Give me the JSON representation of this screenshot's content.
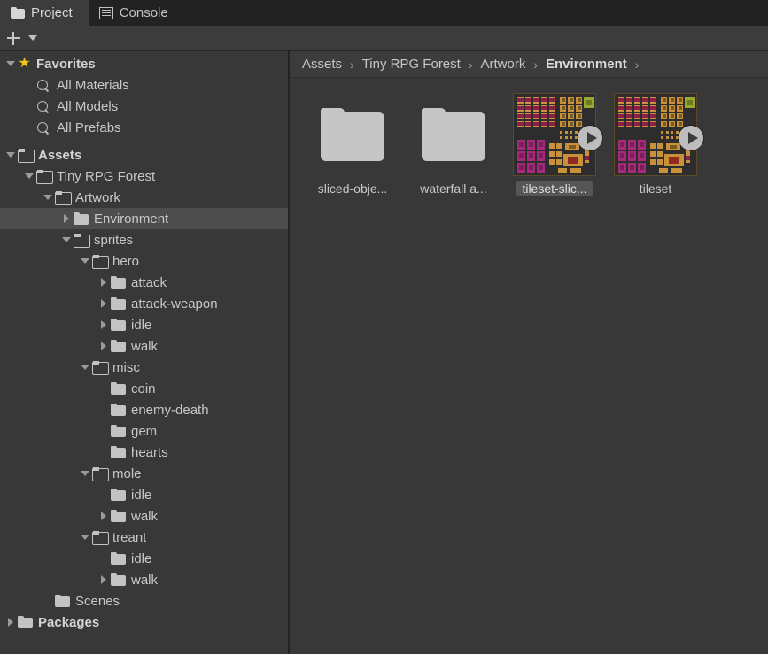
{
  "tabs": [
    {
      "label": "Project",
      "icon": "folder-icon",
      "active": true
    },
    {
      "label": "Console",
      "icon": "console-lines-icon",
      "active": false
    }
  ],
  "toolbar": {
    "add_label": "+",
    "add_icon": "plus-icon",
    "dropdown_icon": "chevron-down-icon"
  },
  "tree": [
    {
      "label": "Favorites",
      "indent": 0,
      "arrow": "down",
      "icon": "star-icon",
      "bold": true,
      "selected": false
    },
    {
      "label": "All Materials",
      "indent": 1,
      "arrow": "none",
      "icon": "search-icon",
      "bold": false,
      "selected": false
    },
    {
      "label": "All Models",
      "indent": 1,
      "arrow": "none",
      "icon": "search-icon",
      "bold": false,
      "selected": false
    },
    {
      "label": "All Prefabs",
      "indent": 1,
      "arrow": "none",
      "icon": "search-icon",
      "bold": false,
      "selected": false
    },
    {
      "label": "",
      "indent": 0,
      "arrow": "none",
      "icon": "spacer",
      "bold": false,
      "selected": false
    },
    {
      "label": "Assets",
      "indent": 0,
      "arrow": "down",
      "icon": "folder-open-icon",
      "bold": true,
      "selected": false
    },
    {
      "label": "Tiny RPG Forest",
      "indent": 1,
      "arrow": "down",
      "icon": "folder-open-icon",
      "bold": false,
      "selected": false
    },
    {
      "label": "Artwork",
      "indent": 2,
      "arrow": "down",
      "icon": "folder-open-icon",
      "bold": false,
      "selected": false
    },
    {
      "label": "Environment",
      "indent": 3,
      "arrow": "right",
      "icon": "folder-icon",
      "bold": false,
      "selected": true
    },
    {
      "label": "sprites",
      "indent": 3,
      "arrow": "down",
      "icon": "folder-open-icon",
      "bold": false,
      "selected": false
    },
    {
      "label": "hero",
      "indent": 4,
      "arrow": "down",
      "icon": "folder-open-icon",
      "bold": false,
      "selected": false
    },
    {
      "label": "attack",
      "indent": 5,
      "arrow": "right",
      "icon": "folder-icon",
      "bold": false,
      "selected": false
    },
    {
      "label": "attack-weapon",
      "indent": 5,
      "arrow": "right",
      "icon": "folder-icon",
      "bold": false,
      "selected": false
    },
    {
      "label": "idle",
      "indent": 5,
      "arrow": "right",
      "icon": "folder-icon",
      "bold": false,
      "selected": false
    },
    {
      "label": "walk",
      "indent": 5,
      "arrow": "right",
      "icon": "folder-icon",
      "bold": false,
      "selected": false
    },
    {
      "label": "misc",
      "indent": 4,
      "arrow": "down",
      "icon": "folder-open-icon",
      "bold": false,
      "selected": false
    },
    {
      "label": "coin",
      "indent": 5,
      "arrow": "none",
      "icon": "folder-icon",
      "bold": false,
      "selected": false
    },
    {
      "label": "enemy-death",
      "indent": 5,
      "arrow": "none",
      "icon": "folder-icon",
      "bold": false,
      "selected": false
    },
    {
      "label": "gem",
      "indent": 5,
      "arrow": "none",
      "icon": "folder-icon",
      "bold": false,
      "selected": false
    },
    {
      "label": "hearts",
      "indent": 5,
      "arrow": "none",
      "icon": "folder-icon",
      "bold": false,
      "selected": false
    },
    {
      "label": "mole",
      "indent": 4,
      "arrow": "down",
      "icon": "folder-open-icon",
      "bold": false,
      "selected": false
    },
    {
      "label": "idle",
      "indent": 5,
      "arrow": "none",
      "icon": "folder-icon",
      "bold": false,
      "selected": false
    },
    {
      "label": "walk",
      "indent": 5,
      "arrow": "right",
      "icon": "folder-icon",
      "bold": false,
      "selected": false
    },
    {
      "label": "treant",
      "indent": 4,
      "arrow": "down",
      "icon": "folder-open-icon",
      "bold": false,
      "selected": false
    },
    {
      "label": "idle",
      "indent": 5,
      "arrow": "none",
      "icon": "folder-icon",
      "bold": false,
      "selected": false
    },
    {
      "label": "walk",
      "indent": 5,
      "arrow": "right",
      "icon": "folder-icon",
      "bold": false,
      "selected": false
    },
    {
      "label": "Scenes",
      "indent": 2,
      "arrow": "none",
      "icon": "folder-icon",
      "bold": false,
      "selected": false
    },
    {
      "label": "Packages",
      "indent": 0,
      "arrow": "right",
      "icon": "folder-icon",
      "bold": true,
      "selected": false
    }
  ],
  "breadcrumb": {
    "separator": "›",
    "items": [
      {
        "label": "Assets",
        "current": false
      },
      {
        "label": "Tiny RPG Forest",
        "current": false
      },
      {
        "label": "Artwork",
        "current": false
      },
      {
        "label": "Environment",
        "current": true
      }
    ],
    "trailing_separator": "›"
  },
  "assets": [
    {
      "label": "sliced-obje...",
      "type": "folder",
      "selected": false,
      "has_play": false
    },
    {
      "label": "waterfall a...",
      "type": "folder",
      "selected": false,
      "has_play": false
    },
    {
      "label": "tileset-slic...",
      "type": "tileset",
      "selected": true,
      "has_play": true
    },
    {
      "label": "tileset",
      "type": "tileset",
      "selected": false,
      "has_play": true
    }
  ],
  "colors": {
    "window_bg": "#383838",
    "tabbar_bg": "#222222",
    "tab_active_bg": "#3c3c3c",
    "toolbar_bg": "#3c3c3c",
    "selection_bg": "#4d4d4d",
    "text": "#c8c8c8",
    "star": "#f5c518",
    "folder_icon": "#c6c6c6",
    "tile_crimson": "#8f1f4a",
    "tile_gold": "#c9923a",
    "tile_olive": "#9aa832",
    "tile_magenta": "#a52a7a",
    "thumb_bg": "#2d2d2d"
  }
}
